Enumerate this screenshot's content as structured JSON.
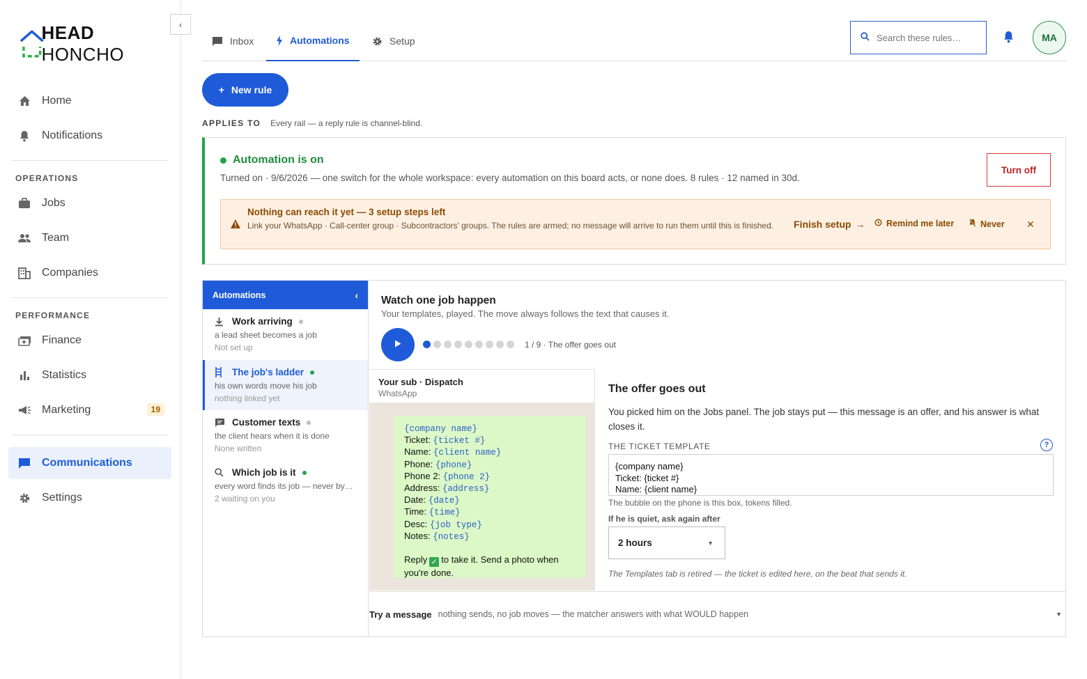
{
  "brand": {
    "logo_bold": "HEAD",
    "logo_rest": " HONCHO"
  },
  "sidebar": {
    "top_items": [
      {
        "label": "Home",
        "icon": "home-icon"
      },
      {
        "label": "Notifications",
        "icon": "bell-icon"
      }
    ],
    "operations_label": "OPERATIONS",
    "operations": [
      {
        "label": "Jobs",
        "icon": "briefcase-icon"
      },
      {
        "label": "Team",
        "icon": "people-icon"
      },
      {
        "label": "Companies",
        "icon": "building-icon"
      }
    ],
    "performance_label": "PERFORMANCE",
    "performance": [
      {
        "label": "Finance",
        "icon": "money-icon"
      },
      {
        "label": "Statistics",
        "icon": "bar-chart-icon"
      },
      {
        "label": "Marketing",
        "icon": "megaphone-icon",
        "badge": "19"
      }
    ],
    "bottom": [
      {
        "label": "Communications",
        "icon": "chat-icon",
        "active": true
      },
      {
        "label": "Settings",
        "icon": "gear-icon"
      }
    ]
  },
  "header": {
    "tabs": [
      {
        "label": "Inbox",
        "icon": "inbox-icon"
      },
      {
        "label": "Automations",
        "icon": "bolt-icon",
        "active": true
      },
      {
        "label": "Setup",
        "icon": "gear-icon"
      }
    ],
    "search_placeholder": "Search these rules…",
    "avatar_initials": "MA"
  },
  "actions": {
    "new_rule": "New rule"
  },
  "applies": {
    "label": "APPLIES TO",
    "text": "Every rail — a reply rule is channel-blind."
  },
  "status": {
    "title": "Automation is on",
    "subtitle": "Turned on · 9/6/2026 — one switch for the whole workspace: every automation on this board acts, or none does. 8 rules · 12 named in 30d.",
    "turn_off": "Turn off",
    "warning": {
      "title": "Nothing can reach it yet — 3 setup steps left",
      "description": "Link your WhatsApp · Call-center group · Subcontractors' groups. The rules are armed; no message will arrive to run them until this is finished.",
      "finish": "Finish setup",
      "remind": "Remind me later",
      "never": "Never"
    }
  },
  "automations": {
    "header": "Automations",
    "items": [
      {
        "title": "Work arriving",
        "desc": "a lead sheet becomes a job",
        "status": "Not set up",
        "icon": "download-icon",
        "dot": "#bdbdbd"
      },
      {
        "title": "The job's ladder",
        "desc": "his own words move his job",
        "status": "nothing linked yet",
        "icon": "ladder-icon",
        "dot": "#22a34a",
        "selected": true
      },
      {
        "title": "Customer texts",
        "desc": "the client hears when it is done",
        "status": "None written",
        "icon": "message-icon",
        "dot": "#bdbdbd"
      },
      {
        "title": "Which job is it",
        "desc": "every word finds its job — never by…",
        "status": "2 waiting on you",
        "icon": "search-icon",
        "dot": "#22a34a"
      }
    ]
  },
  "player": {
    "title": "Watch one job happen",
    "subtitle": "Your templates, played. The move always follows the text that causes it.",
    "current_step": 1,
    "total_steps": 9,
    "step_label": "1 / 9 · The offer goes out"
  },
  "phone": {
    "title": "Your sub · Dispatch",
    "channel": "WhatsApp",
    "lines": [
      {
        "label": "",
        "token": "{company name}"
      },
      {
        "label": "Ticket: ",
        "token": "{ticket #}"
      },
      {
        "label": "Name: ",
        "token": "{client name}"
      },
      {
        "label": "Phone: ",
        "token": "{phone}"
      },
      {
        "label": "Phone 2: ",
        "token": "{phone 2}"
      },
      {
        "label": "Address: ",
        "token": "{address}"
      },
      {
        "label": "Date: ",
        "token": "{date}"
      },
      {
        "label": "Time: ",
        "token": "{time}"
      },
      {
        "label": "Desc: ",
        "token": "{job type}"
      },
      {
        "label": "Notes: ",
        "token": "{notes}"
      }
    ],
    "reply_before": "Reply",
    "reply_after": "to take it. Send a photo when you're done."
  },
  "offer": {
    "title": "The offer goes out",
    "description": "You picked him on the Jobs panel. The job stays put — this message is an offer, and his answer is what closes it.",
    "template_label": "THE TICKET TEMPLATE",
    "help": "?",
    "template_lines": [
      "{company name}",
      "Ticket: {ticket #}",
      "Name: {client name}"
    ],
    "template_hint": "The bubble on the phone is this box, tokens filled.",
    "quiet_label": "If he is quiet, ask again after",
    "quiet_value": "2 hours",
    "retired_note": "The Templates tab is retired — the ticket is edited here, on the beat that sends it."
  },
  "try": {
    "label": "Try a message",
    "hint": "nothing sends, no job moves — the matcher answers with what WOULD happen"
  }
}
